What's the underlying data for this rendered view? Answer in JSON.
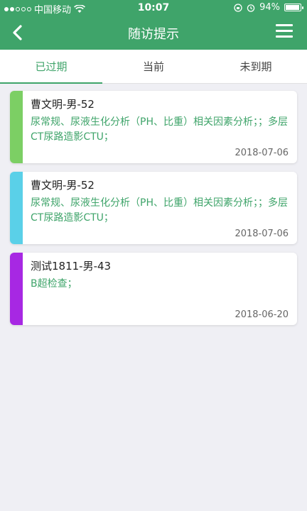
{
  "status_bar": {
    "carrier": "中国移动",
    "time": "10:07",
    "battery": "94%",
    "battery_level": 0.94
  },
  "nav": {
    "title": "随访提示"
  },
  "tabs": [
    {
      "label": "已过期",
      "active": true
    },
    {
      "label": "当前",
      "active": false
    },
    {
      "label": "未到期",
      "active": false
    }
  ],
  "colors": {
    "primary": "#3fa46a",
    "stripe_green": "#7ccf64",
    "stripe_cyan": "#5ad0e8",
    "stripe_purple": "#a728e3"
  },
  "items": [
    {
      "name": "曹文明-男-52",
      "desc": "尿常规、尿液生化分析（PH、比重）相关因素分析；；多层CT尿路造影CTU；",
      "date": "2018-07-06",
      "stripe": "#7ccf64"
    },
    {
      "name": "曹文明-男-52",
      "desc": "尿常规、尿液生化分析（PH、比重）相关因素分析；；多层CT尿路造影CTU；",
      "date": "2018-07-06",
      "stripe": "#5ad0e8"
    },
    {
      "name": "测试1811-男-43",
      "desc": "B超检查；",
      "date": "2018-06-20",
      "stripe": "#a728e3"
    }
  ]
}
